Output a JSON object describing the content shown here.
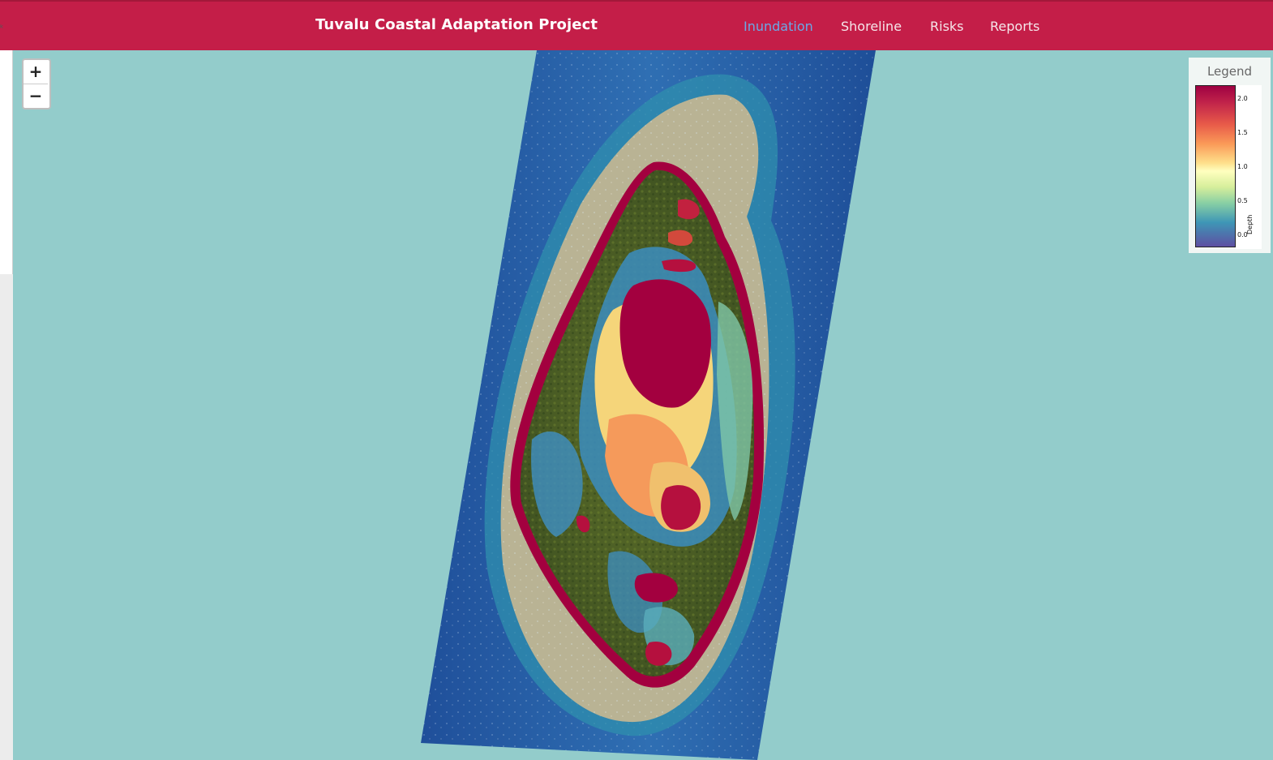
{
  "header": {
    "title": "Tuvalu Coastal Adaptation Project",
    "nav": [
      {
        "label": "Inundation",
        "active": true
      },
      {
        "label": "Shoreline",
        "active": false
      },
      {
        "label": "Risks",
        "active": false
      },
      {
        "label": "Reports",
        "active": false
      }
    ],
    "background_color": "#c41e48",
    "active_color": "#6aa9e6"
  },
  "map": {
    "zoom_in_label": "+",
    "zoom_out_label": "−",
    "water_color": "#93cccb"
  },
  "legend": {
    "title": "Legend",
    "variable": "Depth",
    "ticks": [
      "2.0",
      "1.5",
      "1.0",
      "0.5",
      "0.0"
    ],
    "min": 0.0,
    "max": 2.0,
    "colormap": [
      "#5e4fa2",
      "#3e96b6",
      "#88cfa4",
      "#ffffbf",
      "#fee08b",
      "#fa9a58",
      "#e85b49",
      "#9e0142"
    ]
  }
}
